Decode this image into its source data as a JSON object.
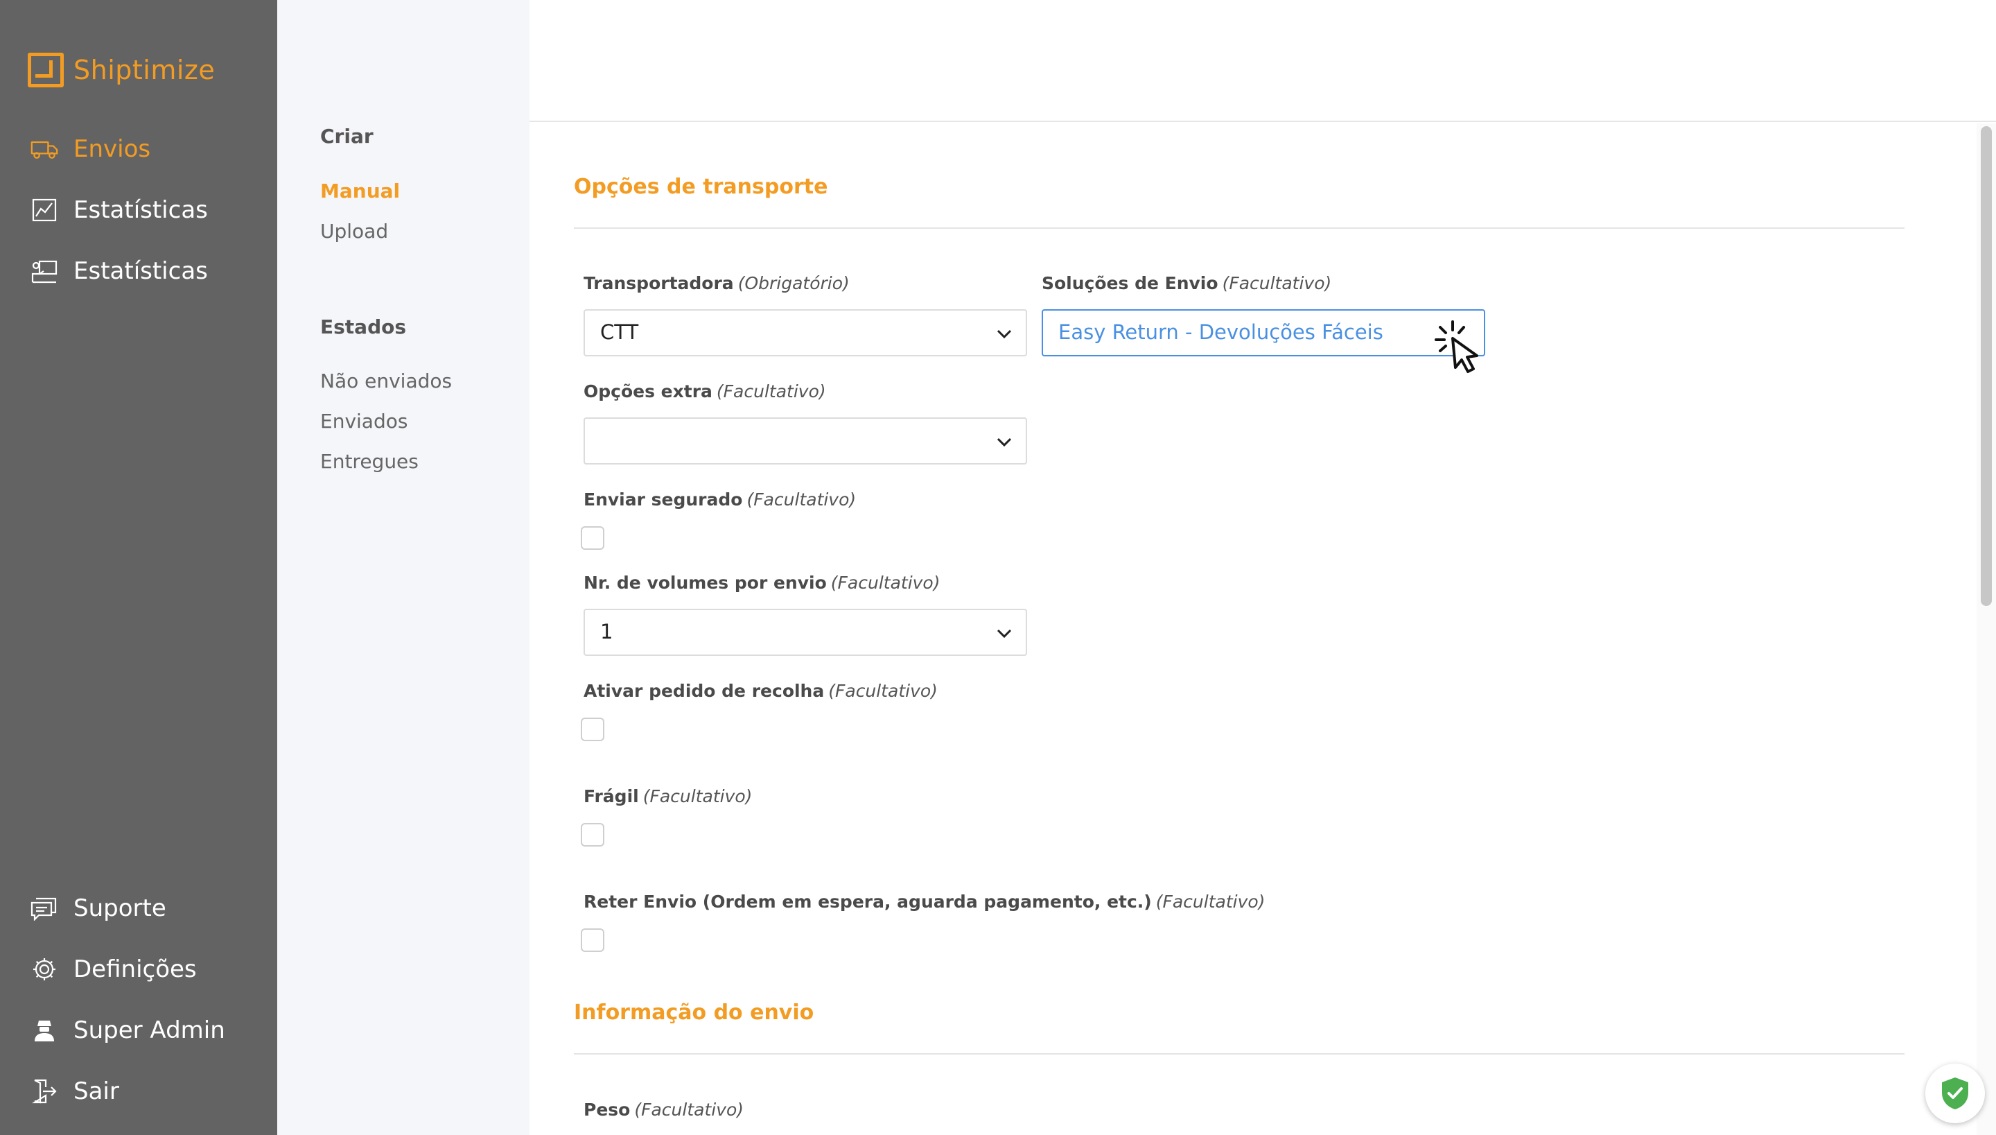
{
  "brand": {
    "name": "Shiptimize",
    "color": "#f39c23"
  },
  "sidebar": {
    "top_items": [
      {
        "label": "Envios",
        "icon": "truck-icon",
        "active": true
      },
      {
        "label": "Estatísticas",
        "icon": "line-chart-icon",
        "active": false
      },
      {
        "label": "Estatísticas",
        "icon": "presentation-chart-icon",
        "active": false
      }
    ],
    "bottom_items": [
      {
        "label": "Suporte",
        "icon": "chat-icon"
      },
      {
        "label": "Definições",
        "icon": "gear-icon"
      },
      {
        "label": "Super Admin",
        "icon": "user-admin-icon"
      },
      {
        "label": "Sair",
        "icon": "logout-icon"
      }
    ]
  },
  "submenu": {
    "create_heading": "Criar",
    "create_links": [
      {
        "label": "Manual",
        "active": true
      },
      {
        "label": "Upload",
        "active": false
      }
    ],
    "states_heading": "Estados",
    "state_links": [
      {
        "label": "Não enviados"
      },
      {
        "label": "Enviados"
      },
      {
        "label": "Entregues"
      }
    ]
  },
  "form": {
    "transport_section_title": "Opções de transporte",
    "fields": {
      "carrier": {
        "label": "Transportadora",
        "qualifier": "(Obrigatório)",
        "value": "CTT"
      },
      "shipping_solutions": {
        "label": "Soluções de Envio",
        "qualifier": "(Facultativo)",
        "value": "Easy Return - Devoluções Fáceis"
      },
      "extra_options": {
        "label": "Opções extra",
        "qualifier": "(Facultativo)",
        "value": ""
      },
      "insured": {
        "label": "Enviar segurado",
        "qualifier": "(Facultativo)",
        "checked": false
      },
      "volumes": {
        "label": "Nr. de volumes por envio",
        "qualifier": "(Facultativo)",
        "value": "1"
      },
      "pickup": {
        "label": "Ativar pedido de recolha",
        "qualifier": "(Facultativo)",
        "checked": false
      },
      "fragile": {
        "label": "Frágil",
        "qualifier": "(Facultativo)",
        "checked": false
      },
      "hold": {
        "label": "Reter Envio (Ordem em espera, aguarda pagamento, etc.)",
        "qualifier": "(Facultativo)",
        "checked": false
      }
    },
    "shipment_section_title": "Informação do envio",
    "weight": {
      "label": "Peso",
      "qualifier": "(Facultativo)"
    }
  },
  "colors": {
    "accent": "#f39c23",
    "sidebar_bg": "#636363",
    "focus_blue": "#4a90e2",
    "badge_green": "#4caf50"
  }
}
